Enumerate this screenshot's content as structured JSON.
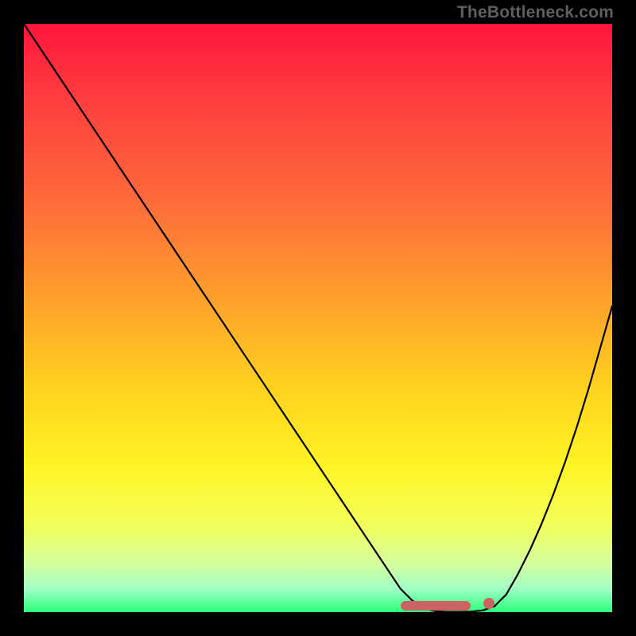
{
  "watermark": "TheBottleneck.com",
  "colors": {
    "marker": "#cc6262",
    "curve": "#000000"
  },
  "chart_data": {
    "type": "line",
    "title": "",
    "xlabel": "",
    "ylabel": "",
    "xlim": [
      0,
      100
    ],
    "ylim": [
      0,
      100
    ],
    "x": [
      0,
      2,
      4,
      6,
      8,
      10,
      12,
      14,
      16,
      18,
      20,
      22,
      24,
      26,
      28,
      30,
      32,
      34,
      36,
      38,
      40,
      42,
      44,
      46,
      48,
      50,
      52,
      54,
      56,
      58,
      60,
      62,
      64,
      66,
      68,
      70,
      72,
      74,
      76,
      78,
      80,
      82,
      84,
      86,
      88,
      90,
      92,
      94,
      96,
      98,
      100
    ],
    "y": [
      100,
      97.0,
      94.0,
      91.0,
      88.0,
      85.0,
      82.0,
      79.0,
      76.0,
      73.0,
      70.0,
      67.0,
      64.0,
      61.0,
      58.0,
      55.0,
      52.0,
      49.0,
      46.0,
      43.0,
      40.0,
      37.0,
      34.0,
      31.0,
      28.0,
      25.0,
      22.0,
      19.0,
      16.0,
      13.0,
      10.0,
      7.0,
      4.0,
      2.0,
      0.6,
      0.15,
      0.05,
      0.05,
      0.1,
      0.3,
      1.0,
      3.0,
      6.5,
      10.5,
      15.0,
      20.0,
      25.5,
      31.5,
      38.0,
      45.0,
      52.0
    ],
    "optimal_range_x": [
      64,
      76
    ],
    "optimal_point_x": 79
  }
}
